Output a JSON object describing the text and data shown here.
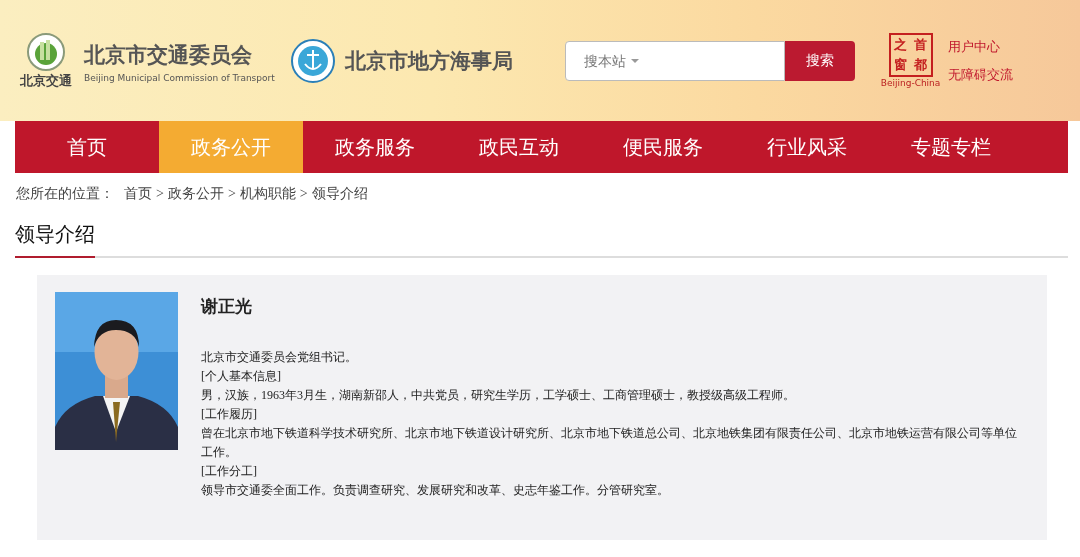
{
  "header": {
    "logo_1": {
      "caption": "北京交通"
    },
    "org_name": "北京市交通委员会",
    "org_name_en": "Beijing Municipal Commission of Transport",
    "org_name_2": "北京市地方海事局",
    "search": {
      "placeholder": "搜本站",
      "button": "搜索"
    },
    "seal": {
      "chars": [
        "之",
        "首",
        "窗",
        "都"
      ],
      "caption": "Beijing-China"
    },
    "links": [
      "用户中心",
      "无障碍交流"
    ]
  },
  "nav": [
    {
      "label": "首页",
      "selected": false
    },
    {
      "label": "政务公开",
      "selected": true
    },
    {
      "label": "政务服务",
      "selected": false
    },
    {
      "label": "政民互动",
      "selected": false
    },
    {
      "label": "便民服务",
      "selected": false
    },
    {
      "label": "行业风采",
      "selected": false
    },
    {
      "label": "专题专栏",
      "selected": false
    }
  ],
  "breadcrumb": {
    "prefix": "您所在的位置：",
    "items": [
      "首页",
      "政务公开",
      "机构职能",
      "领导介绍"
    ],
    "separator": ">"
  },
  "section_title": "领导介绍",
  "profile": {
    "name": "谢正光",
    "paragraphs": [
      "北京市交通委员会党组书记。",
      "[个人基本信息]",
      "男，汉族，1963年3月生，湖南新邵人，中共党员，研究生学历，工学硕士、工商管理硕士，教授级高级工程师。",
      "[工作履历]",
      "曾在北京市地下铁道科学技术研究所、北京市地下铁道设计研究所、北京市地下铁道总公司、北京地铁集团有限责任公司、北京市地铁运营有限公司等单位工作。",
      "[工作分工]",
      "领导市交通委全面工作。负责调查研究、发展研究和改革、史志年鉴工作。分管研究室。"
    ]
  }
}
